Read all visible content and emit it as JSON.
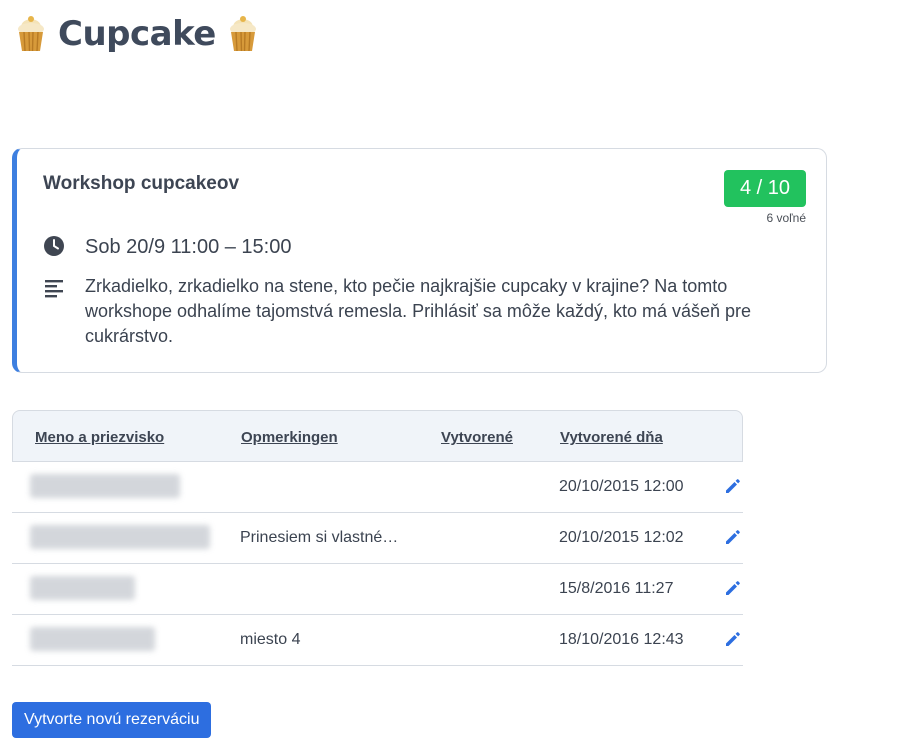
{
  "app": {
    "title": "Cupcake",
    "logo_icon": "cupcake-icon"
  },
  "event": {
    "title": "Workshop cupcakeov",
    "capacity": "4 / 10",
    "free": "6 voľné",
    "datetime": "Sob 20/9  11:00 – 15:00",
    "description": "Zrkadielko, zrkadielko na stene, kto pečie najkrajšie cupcaky v krajine? Na tomto workshope odhalíme tajomstvá remesla. Prihlásiť sa môže každý, kto má vášeň pre cukrárstvo.",
    "datetime_icon": "clock-icon",
    "description_icon": "text-lines-icon",
    "accent_color": "#3d7fe0",
    "badge_color": "#22c25e"
  },
  "table": {
    "columns": [
      "Meno a priezvisko",
      "Opmerkingen",
      "Vytvorené",
      "Vytvorené dňa"
    ],
    "rows": [
      {
        "name": "",
        "note": "",
        "created": "",
        "created_on": "20/10/2015 12:00"
      },
      {
        "name": "",
        "note": "Prinesiem si vlastné…",
        "created": "",
        "created_on": "20/10/2015 12:02"
      },
      {
        "name": "",
        "note": "",
        "created": "",
        "created_on": "15/8/2016 11:27"
      },
      {
        "name": "",
        "note": "miesto 4",
        "created": "",
        "created_on": "18/10/2016 12:43"
      }
    ],
    "edit_icon": "pencil-icon"
  },
  "actions": {
    "new_reservation": "Vytvorte novú rezerváciu",
    "button_color": "#2d6ee0"
  }
}
